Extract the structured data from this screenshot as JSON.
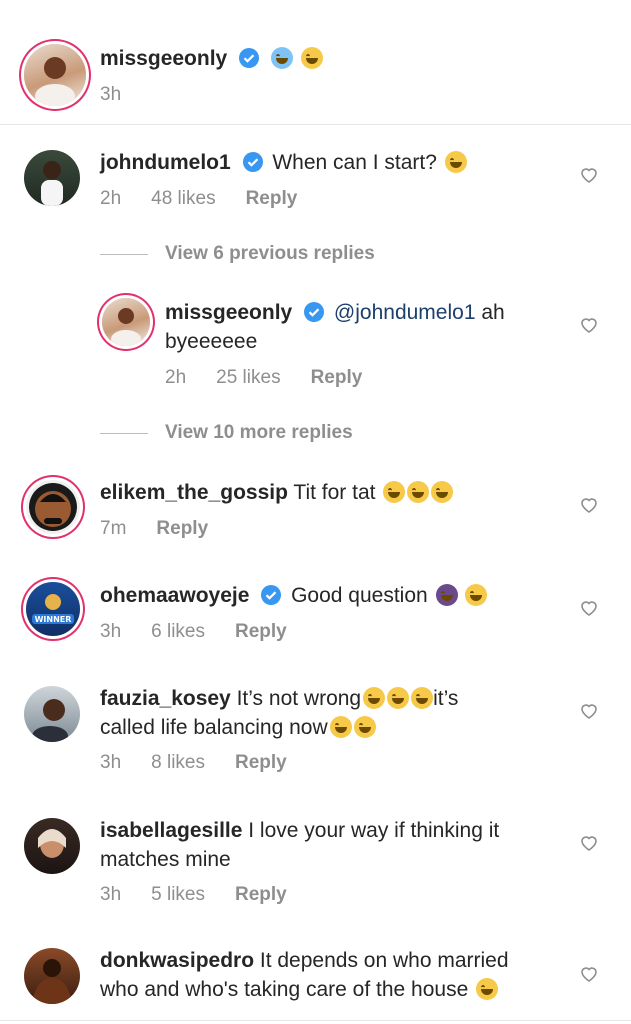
{
  "post": {
    "username": "missgeeonly",
    "emojis": [
      "scream-emoji",
      "mind-blown-emoji"
    ],
    "time": "3h"
  },
  "comments": [
    {
      "username": "johndumelo1",
      "verified": true,
      "text": "When can I start?",
      "time": "2h",
      "likes": "48 likes",
      "reply": "Reply",
      "view_previous": "View 6 previous replies",
      "view_more": "View 10 more replies",
      "replies": [
        {
          "username": "missgeeonly",
          "verified": true,
          "mention": "@johndumelo1",
          "text_after_mention": " ah",
          "text_line2": "byeeeeee",
          "time": "2h",
          "likes": "25 likes",
          "reply": "Reply"
        }
      ]
    },
    {
      "username": "elikem_the_gossip",
      "text": "Tit for tat",
      "time": "7m",
      "reply": "Reply"
    },
    {
      "username": "ohemaawoyeje",
      "verified": true,
      "text": "Good question",
      "avatar_badge": "WINNER",
      "time": "3h",
      "likes": "6 likes",
      "reply": "Reply"
    },
    {
      "username": "fauzia_kosey",
      "text": "It’s not wrong",
      "text_mid": "it’s",
      "text_line2": "called life balancing now",
      "time": "3h",
      "likes": "8 likes",
      "reply": "Reply"
    },
    {
      "username": "isabellagesille",
      "text": "I love your way if thinking it",
      "text_line2": "matches mine",
      "time": "3h",
      "likes": "5 likes",
      "reply": "Reply"
    },
    {
      "username": "donkwasipedro",
      "text": "It depends on who married",
      "text_line2": "who and who's taking care of the house"
    }
  ],
  "colors": {
    "text": "#262626",
    "meta": "#8e8e8e",
    "mention": "#1d3f6e",
    "verified": "#3897f0",
    "story_ring": "#e1306c"
  }
}
